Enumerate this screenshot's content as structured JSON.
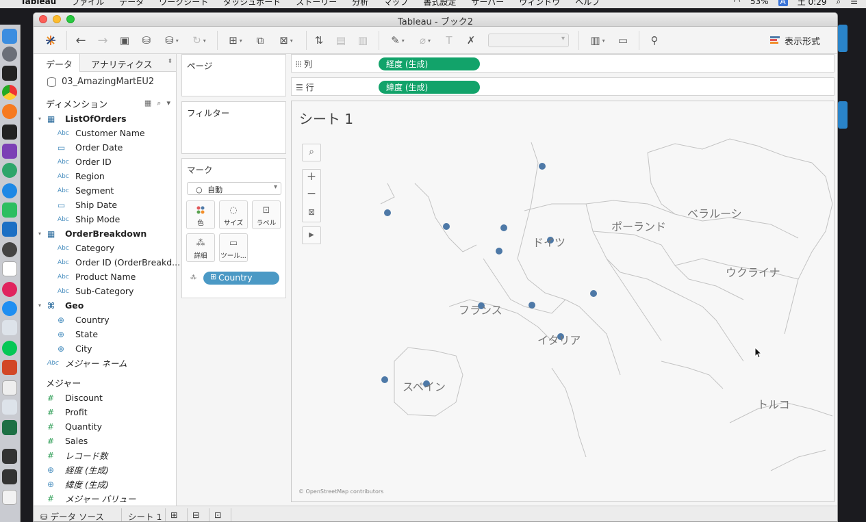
{
  "menubar": {
    "items": [
      "Tableau",
      "ファイル",
      "データ",
      "ワークシート",
      "ダッシュボード",
      "ストーリー",
      "分析",
      "マップ",
      "書式設定",
      "サーバー",
      "ウィンドウ",
      "ヘルプ"
    ],
    "battery": "53%",
    "input": "A",
    "clock": "土 0:29"
  },
  "window": {
    "title": "Tableau - ブック2"
  },
  "toolbar": {
    "show_me_label": "表示形式"
  },
  "datapane": {
    "tab_data": "データ",
    "tab_analytics": "アナリティクス",
    "datasource": "03_AmazingMartEU2",
    "dimensions_header": "ディメンション",
    "measures_header": "メジャー",
    "tables": [
      {
        "name": "ListOfOrders",
        "fields": [
          {
            "type": "Abc",
            "name": "Customer Name"
          },
          {
            "type": "date",
            "name": "Order Date"
          },
          {
            "type": "Abc",
            "name": "Order ID"
          },
          {
            "type": "Abc",
            "name": "Region"
          },
          {
            "type": "Abc",
            "name": "Segment"
          },
          {
            "type": "date",
            "name": "Ship Date"
          },
          {
            "type": "Abc",
            "name": "Ship Mode"
          }
        ]
      },
      {
        "name": "OrderBreakdown",
        "fields": [
          {
            "type": "Abc",
            "name": "Category"
          },
          {
            "type": "Abc",
            "name": "Order ID (OrderBreakd..."
          },
          {
            "type": "Abc",
            "name": "Product Name"
          },
          {
            "type": "Abc",
            "name": "Sub-Category"
          }
        ]
      },
      {
        "name": "Geo",
        "fields": [
          {
            "type": "geo",
            "name": "Country"
          },
          {
            "type": "geo",
            "name": "State"
          },
          {
            "type": "geo",
            "name": "City"
          }
        ]
      }
    ],
    "measure_names": "メジャー ネーム",
    "measures": [
      {
        "type": "#",
        "name": "Discount"
      },
      {
        "type": "#",
        "name": "Profit"
      },
      {
        "type": "#",
        "name": "Quantity"
      },
      {
        "type": "#",
        "name": "Sales"
      },
      {
        "type": "#",
        "name": "レコード数"
      },
      {
        "type": "geo",
        "name": "経度 (生成)"
      },
      {
        "type": "geo",
        "name": "緯度 (生成)"
      },
      {
        "type": "#",
        "name": "メジャー バリュー"
      }
    ]
  },
  "cards": {
    "pages": "ページ",
    "filters": "フィルター",
    "marks": "マーク",
    "mark_type": "自動",
    "mark_buttons": [
      "色",
      "サイズ",
      "ラベル",
      "詳細",
      "ツール..."
    ],
    "detail_pill": "Country"
  },
  "shelves": {
    "columns_label": "列",
    "columns_pill": "経度 (生成)",
    "rows_label": "行",
    "rows_pill": "緯度 (生成)"
  },
  "view": {
    "sheet_title": "シート 1",
    "attribution": "© OpenStreetMap contributors",
    "country_labels": [
      "ポーランド",
      "ベラルーシ",
      "ウクライナ",
      "ドイツ",
      "フランス",
      "イタリア",
      "スペイン",
      "トルコ"
    ],
    "mark_color": "#4e79a7"
  },
  "bottom_tabs": {
    "datasource": "データ ソース",
    "sheet": "シート 1"
  },
  "colors": {
    "pill_green": "#12a36a",
    "pill_blue": "#4b99c5"
  }
}
